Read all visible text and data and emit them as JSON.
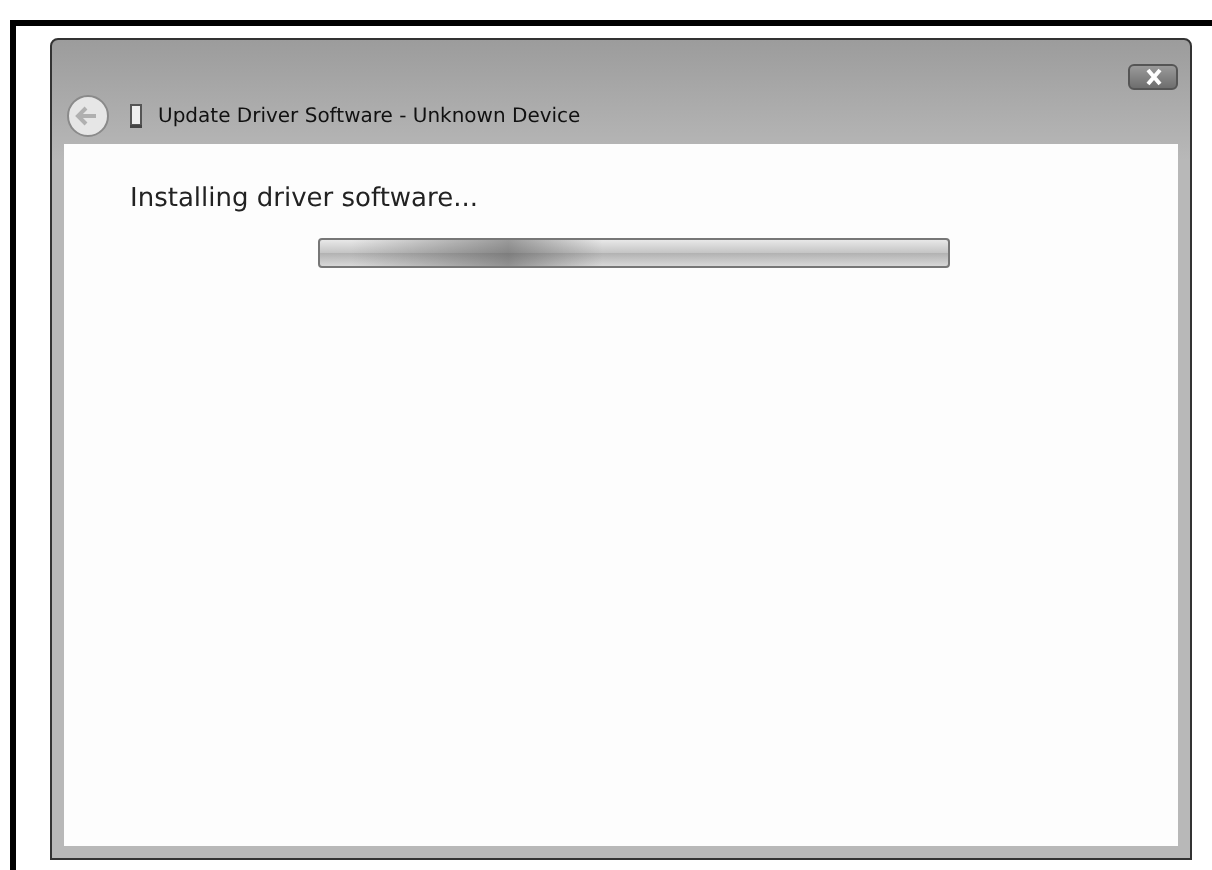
{
  "window": {
    "title": "Update Driver Software - Unknown Device"
  },
  "heading": "Installing driver software...",
  "progress": {
    "kind": "marquee"
  }
}
